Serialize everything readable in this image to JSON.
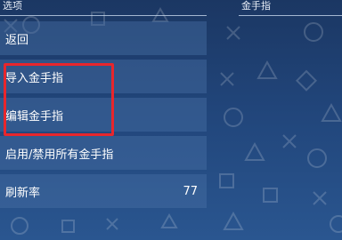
{
  "headers": {
    "left": "选项",
    "right": "金手指"
  },
  "menu": {
    "items": [
      {
        "label": "返回",
        "value": ""
      },
      {
        "label": "导入金手指",
        "value": ""
      },
      {
        "label": "编辑金手指",
        "value": ""
      },
      {
        "label": "启用/禁用所有金手指",
        "value": ""
      },
      {
        "label": "刷新率",
        "value": "77"
      }
    ]
  },
  "colors": {
    "background": "#21457a",
    "highlight": "#e8262c",
    "item_bg": "#466ea5"
  },
  "icons": [
    "circle-icon",
    "cross-icon",
    "square-icon",
    "triangle-icon"
  ]
}
